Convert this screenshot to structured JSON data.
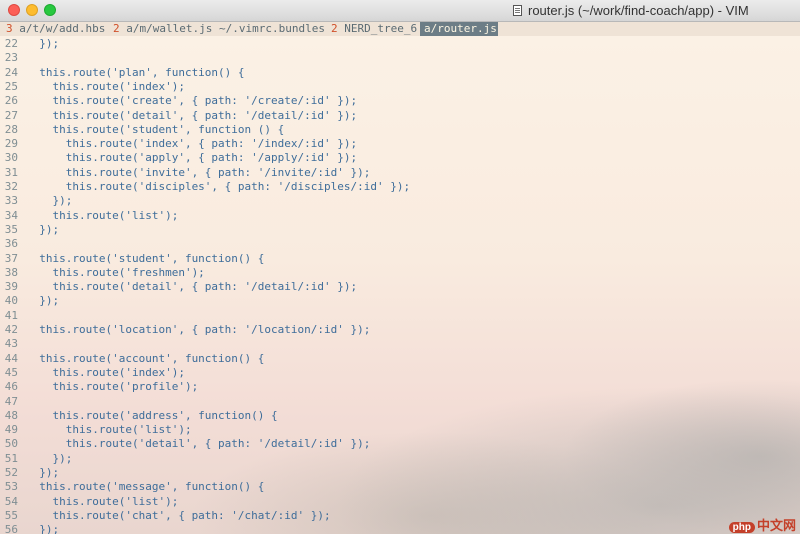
{
  "window": {
    "title": "router.js (~/work/find-coach/app) - VIM"
  },
  "tabs": [
    {
      "num": "3",
      "label": " a/t/w/add.hbs",
      "active": false
    },
    {
      "num": "2",
      "label": " a/m/wallet.js",
      "active": false
    },
    {
      "num": "",
      "label": "~/.vimrc.bundles",
      "active": false
    },
    {
      "num": "2",
      "label": " NERD_tree_6",
      "active": false
    },
    {
      "num": "",
      "label": "a/router.js",
      "active": true
    }
  ],
  "colors": {
    "code": "#3e6d9a",
    "line_number": "#7f8e93",
    "tab_number": "#d0502a",
    "active_tab_bg": "#6c7d86"
  },
  "editor": {
    "lines": [
      {
        "n": "22",
        "t": "  });"
      },
      {
        "n": "23",
        "t": ""
      },
      {
        "n": "24",
        "t": "  this.route('plan', function() {"
      },
      {
        "n": "25",
        "t": "    this.route('index');"
      },
      {
        "n": "26",
        "t": "    this.route('create', { path: '/create/:id' });"
      },
      {
        "n": "27",
        "t": "    this.route('detail', { path: '/detail/:id' });"
      },
      {
        "n": "28",
        "t": "    this.route('student', function () {"
      },
      {
        "n": "29",
        "t": "      this.route('index', { path: '/index/:id' });"
      },
      {
        "n": "30",
        "t": "      this.route('apply', { path: '/apply/:id' });"
      },
      {
        "n": "31",
        "t": "      this.route('invite', { path: '/invite/:id' });"
      },
      {
        "n": "32",
        "t": "      this.route('disciples', { path: '/disciples/:id' });"
      },
      {
        "n": "33",
        "t": "    });"
      },
      {
        "n": "34",
        "t": "    this.route('list');"
      },
      {
        "n": "35",
        "t": "  });"
      },
      {
        "n": "36",
        "t": ""
      },
      {
        "n": "37",
        "t": "  this.route('student', function() {"
      },
      {
        "n": "38",
        "t": "    this.route('freshmen');"
      },
      {
        "n": "39",
        "t": "    this.route('detail', { path: '/detail/:id' });"
      },
      {
        "n": "40",
        "t": "  });"
      },
      {
        "n": "41",
        "t": ""
      },
      {
        "n": "42",
        "t": "  this.route('location', { path: '/location/:id' });"
      },
      {
        "n": "43",
        "t": ""
      },
      {
        "n": "44",
        "t": "  this.route('account', function() {"
      },
      {
        "n": "45",
        "t": "    this.route('index');"
      },
      {
        "n": "46",
        "t": "    this.route('profile');"
      },
      {
        "n": "47",
        "t": ""
      },
      {
        "n": "48",
        "t": "    this.route('address', function() {"
      },
      {
        "n": "49",
        "t": "      this.route('list');"
      },
      {
        "n": "50",
        "t": "      this.route('detail', { path: '/detail/:id' });"
      },
      {
        "n": "51",
        "t": "    });"
      },
      {
        "n": "52",
        "t": "  });"
      },
      {
        "n": "53",
        "t": "  this.route('message', function() {"
      },
      {
        "n": "54",
        "t": "    this.route('list');"
      },
      {
        "n": "55",
        "t": "    this.route('chat', { path: '/chat/:id' });"
      },
      {
        "n": "56",
        "t": "  });"
      }
    ]
  },
  "watermark": {
    "badge": "php",
    "text": "中文网"
  }
}
